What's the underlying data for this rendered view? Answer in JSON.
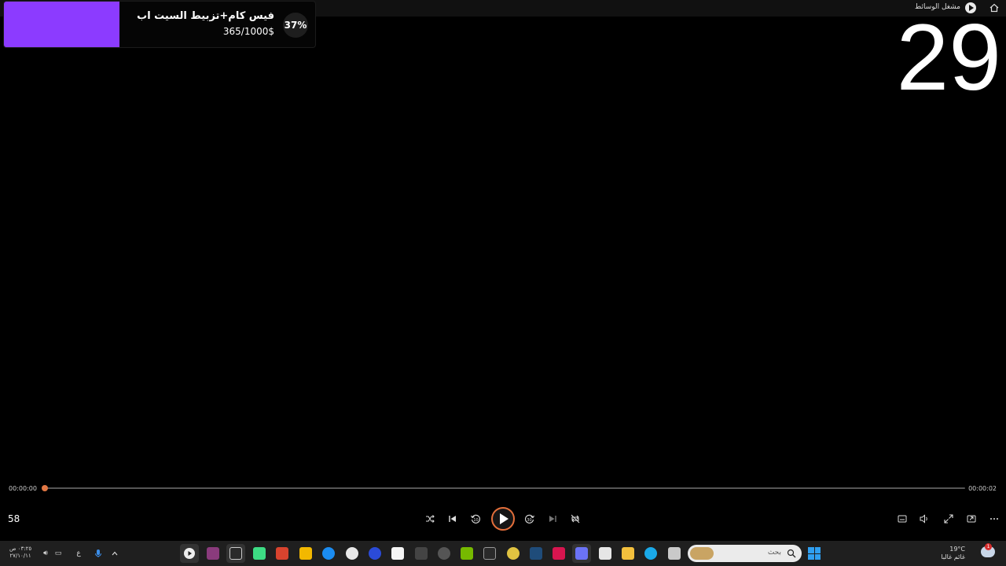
{
  "titlebar": {
    "title": "مشغل الوسائط"
  },
  "donation_goal": {
    "title": "فيس كام+تزبيط السيت اب",
    "amount": "365/1000$",
    "percent": "37%",
    "progress_fraction": 0.37,
    "fill_color": "#8c3bff"
  },
  "counter": "29",
  "player": {
    "time_current": "00:00:00",
    "time_total": "00:00:02",
    "counter_small": "58",
    "accent_color": "#e46f3b"
  },
  "controls": [
    {
      "name": "shuffle-icon"
    },
    {
      "name": "previous-icon"
    },
    {
      "name": "rewind-10-icon",
      "label": "10"
    },
    {
      "name": "play-icon"
    },
    {
      "name": "forward-30-icon",
      "label": "30"
    },
    {
      "name": "next-icon"
    },
    {
      "name": "repeat-off-icon"
    },
    {
      "name": "captions-icon"
    },
    {
      "name": "volume-icon"
    },
    {
      "name": "fullscreen-icon"
    },
    {
      "name": "mini-player-icon"
    },
    {
      "name": "more-icon"
    }
  ],
  "taskbar": {
    "clock_time": "٠٣:٢٥ ص",
    "clock_date": "٢٧/١٠/١١",
    "language": "ع",
    "search_placeholder": "بحث",
    "weather_temp": "19°C",
    "weather_desc": "غائم غالبا",
    "notification_count": "1",
    "apps": [
      "media-player-icon",
      "winrar-icon",
      "epic-games-icon",
      "android-studio-icon",
      "voicemeeter-icon",
      "rockstar-icon",
      "tiktok-icon",
      "whatsapp-icon",
      "ea-icon",
      "capcut-icon",
      "bluestacks-icon",
      "chrome-icon",
      "nvidia-icon",
      "epic-games-icon-2",
      "chrome-beta-icon",
      "steam-icon",
      "adobe-icon",
      "discord-icon",
      "store-icon",
      "file-explorer-icon",
      "edge-icon",
      "task-view-icon"
    ]
  }
}
